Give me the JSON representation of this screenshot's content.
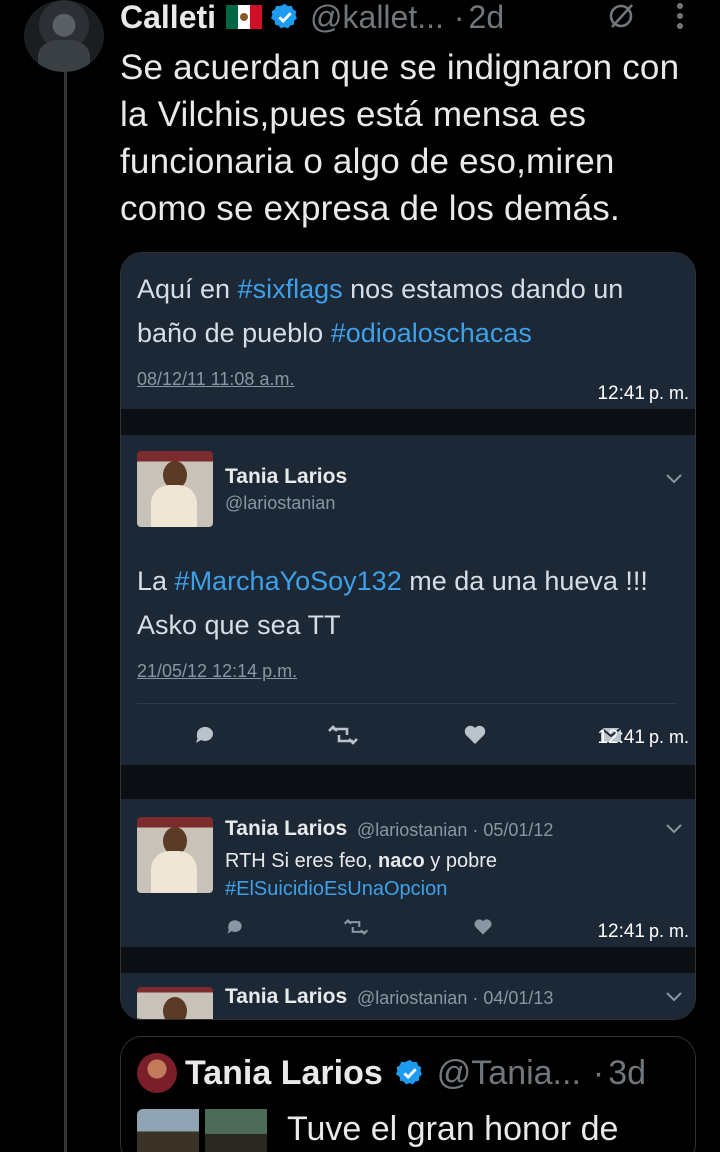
{
  "tweet": {
    "name": "Calleti",
    "handle": "@kallet...",
    "dot": "·",
    "age": "2d",
    "text": "Se acuerdan que se indignaron con la Vilchis,pues está mensa es funcionaria o algo de eso,miren como se expresa de los demás.",
    "icons": [
      "mexico-flag-icon",
      "verified-badge-icon",
      "grok-icon",
      "more-options-icon"
    ]
  },
  "media": {
    "post1": {
      "text_before": "Aquí en ",
      "hashtag1": "#sixflags",
      "text_middle": " nos estamos dando un baño de pueblo ",
      "hashtag2": "#odioaloschacas",
      "timestamp": "08/12/11 11:08 a.m.",
      "caption_time": "12:41",
      "caption_ampm": "p. m."
    },
    "post2": {
      "name": "Tania Larios",
      "handle": "@lariostanian",
      "text_before": "La ",
      "hashtag": "#MarchaYoSoy132",
      "text_after": " me da una hueva !!! Asko que sea TT",
      "timestamp": "21/05/12 12:14 p.m.",
      "caption_time": "12:41",
      "caption_ampm": "p. m.",
      "actions": [
        "reply-icon",
        "retweet-icon",
        "like-icon",
        "message-icon"
      ]
    },
    "post3": {
      "name": "Tania Larios",
      "handle": "@lariostanian · 05/01/12",
      "text_before": "RTH Si eres feo, ",
      "bold": "naco",
      "text_after": " y pobre",
      "hashtag": "#ElSuicidioEsUnaOpcion",
      "caption_time": "12:41",
      "caption_ampm": "p. m."
    },
    "post4": {
      "name": "Tania Larios",
      "handle": "@lariostanian · 04/01/13"
    }
  },
  "quote": {
    "name": "Tania Larios",
    "handle": "@Tania...",
    "dot": "·",
    "age": "3d",
    "text": "Tuve el gran honor de"
  },
  "colors": {
    "background": "#000000",
    "panel": "#1c2836",
    "hashtag": "#3ea1e8",
    "verified": "#1d9bf0",
    "muted": "#71767b"
  }
}
